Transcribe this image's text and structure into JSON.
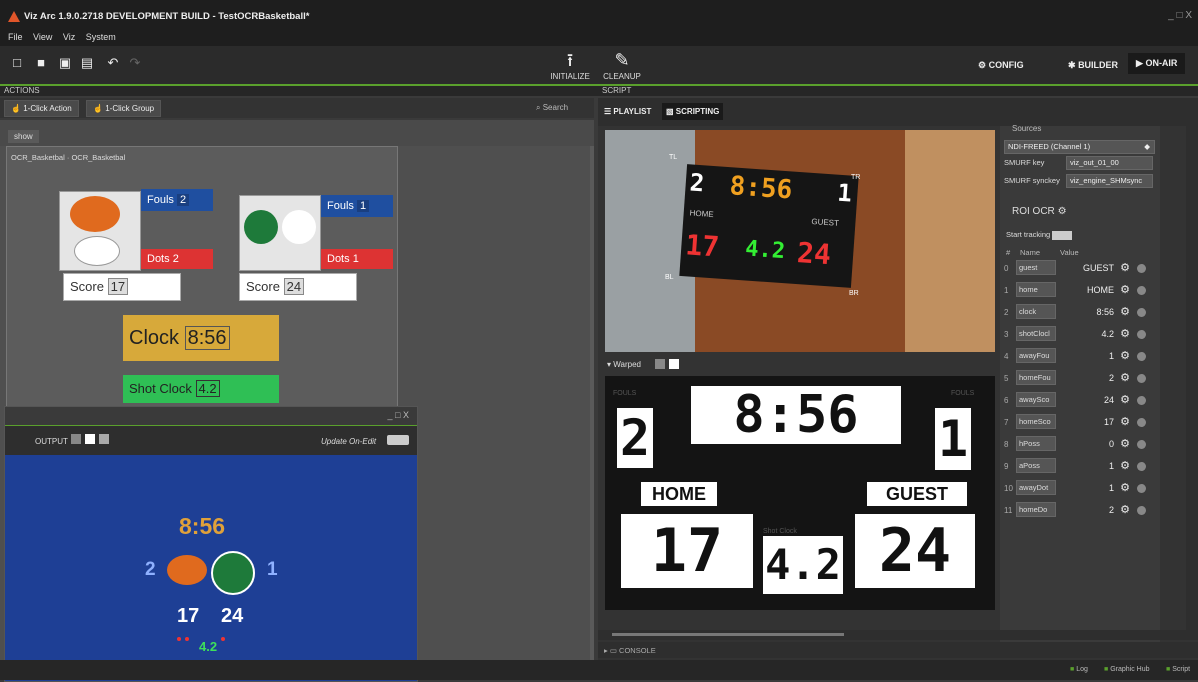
{
  "app": {
    "title": "Viz Arc 1.9.0.2718 DEVELOPMENT BUILD - TestOCRBasketball*",
    "menu": [
      "File",
      "View",
      "Viz",
      "System"
    ],
    "window_controls": "_ □ X"
  },
  "toolbar": {
    "initialize_label": "INITIALIZE",
    "cleanup_label": "CLEANUP",
    "config_label": "CONFIG",
    "builder_label": "BUILDER",
    "onair_label": "ON-AIR"
  },
  "actions": {
    "header": "ACTIONS",
    "one_click_action": "1-Click Action",
    "one_click_group": "1-Click Group",
    "search_placeholder": "Search",
    "tab": "show",
    "breadcrumb": "OCR_Basketbal · OCR_Basketbal",
    "home": {
      "fouls_label": "Fouls",
      "fouls": "2",
      "dots_label": "Dots",
      "dots": "2",
      "score_label": "Score",
      "score": "17"
    },
    "away": {
      "fouls_label": "Fouls",
      "fouls": "1",
      "dots_label": "Dots",
      "dots": "1",
      "score_label": "Score",
      "score": "24"
    },
    "clock_label": "Clock",
    "clock": "8:56",
    "shot_clock_label": "Shot Clock",
    "shot_clock": "4.2"
  },
  "output": {
    "label": "OUTPUT",
    "update_label": "Update On-Edit",
    "clock": "8:56",
    "left_fouls": "2",
    "right_fouls": "1",
    "home_score": "17",
    "away_score": "24",
    "shot_clock": "4.2",
    "win_controls": "_ □ X"
  },
  "script": {
    "header": "SCRIPT",
    "playlist_tab": "PLAYLIST",
    "scripting_tab": "SCRIPTING",
    "console_label": "CONSOLE",
    "warped_label": "Warped"
  },
  "camera": {
    "corner_tl": "TL",
    "corner_tr": "TR",
    "corner_bl": "BL",
    "corner_br": "BR",
    "clock": "8:56",
    "left": "2",
    "right": "1",
    "home": "17",
    "guest": "24",
    "shot": "4.2",
    "home_label": "HOME",
    "guest_label": "GUEST"
  },
  "warped": {
    "left": "2",
    "clock": "8:56",
    "right": "1",
    "home_label": "HOME",
    "guest_label": "GUEST",
    "home": "17",
    "shot": "4.2",
    "guest": "24",
    "shot_clock_text": "Shot Clock",
    "fouls_text": "FOULS"
  },
  "sources": {
    "header": "Sources",
    "channel": "NDI-FREED (Channel 1)",
    "smurf_key_label": "SMURF key",
    "smurf_key": "viz_out_01_00",
    "smurf_sync_label": "SMURF synckey",
    "smurf_sync": "viz_engine_SHMsync"
  },
  "roi": {
    "header": "ROI OCR",
    "start_tracking": "Start tracking",
    "col_index": "#",
    "col_name": "Name",
    "col_value": "Value",
    "rows": [
      {
        "i": "0",
        "name": "guest",
        "value": "GUEST"
      },
      {
        "i": "1",
        "name": "home",
        "value": "HOME"
      },
      {
        "i": "2",
        "name": "clock",
        "value": "8:56"
      },
      {
        "i": "3",
        "name": "shotClocl",
        "value": "4.2"
      },
      {
        "i": "4",
        "name": "awayFou",
        "value": "1"
      },
      {
        "i": "5",
        "name": "homeFou",
        "value": "2"
      },
      {
        "i": "6",
        "name": "awaySco",
        "value": "24"
      },
      {
        "i": "7",
        "name": "homeSco",
        "value": "17"
      },
      {
        "i": "8",
        "name": "hPoss",
        "value": "0"
      },
      {
        "i": "9",
        "name": "aPoss",
        "value": "1"
      },
      {
        "i": "10",
        "name": "awayDot",
        "value": "1"
      },
      {
        "i": "11",
        "name": "homeDo",
        "value": "2"
      }
    ]
  },
  "status": {
    "log": "Log",
    "graphic_hub": "Graphic Hub",
    "script": "Script"
  }
}
